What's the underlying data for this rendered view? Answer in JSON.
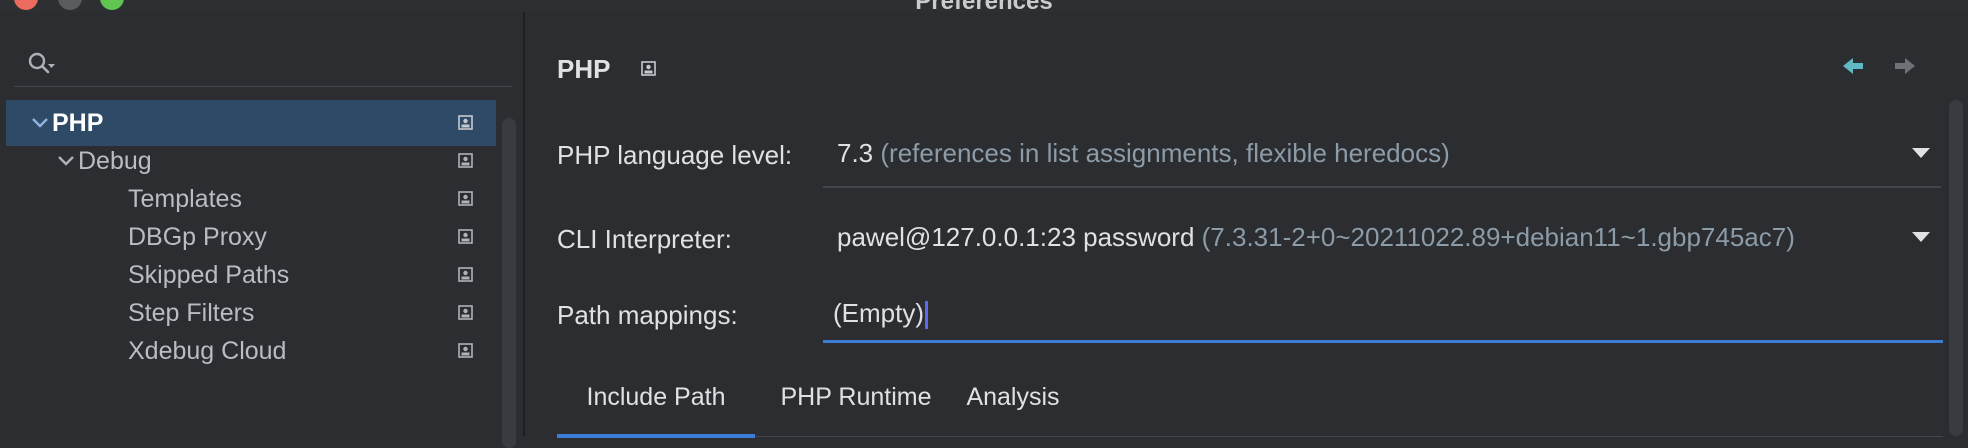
{
  "window": {
    "title": "Preferences"
  },
  "search": {
    "value": "",
    "placeholder": ""
  },
  "sidebar": {
    "items": [
      {
        "label": "PHP",
        "level": 0,
        "expanded": true,
        "selected": true
      },
      {
        "label": "Debug",
        "level": 1,
        "expanded": true,
        "selected": false
      },
      {
        "label": "Templates",
        "level": 2,
        "selected": false
      },
      {
        "label": "DBGp Proxy",
        "level": 2,
        "selected": false
      },
      {
        "label": "Skipped Paths",
        "level": 2,
        "selected": false
      },
      {
        "label": "Step Filters",
        "level": 2,
        "selected": false
      },
      {
        "label": "Xdebug Cloud",
        "level": 2,
        "selected": false
      }
    ]
  },
  "main": {
    "title": "PHP",
    "language_level": {
      "label": "PHP language level:",
      "value": "7.3",
      "detail": "(references in list assignments, flexible heredocs)"
    },
    "cli_interpreter": {
      "label": "CLI Interpreter:",
      "value": "pawel@127.0.0.1:23 password",
      "detail": "(7.3.31-2+0~20211022.89+debian11~1.gbp745ac7)"
    },
    "path_mappings": {
      "label": "Path mappings:",
      "value": "(Empty)"
    },
    "tabs": [
      {
        "label": "Include Path",
        "active": true
      },
      {
        "label": "PHP Runtime",
        "active": false
      },
      {
        "label": "Analysis",
        "active": false
      }
    ]
  },
  "colors": {
    "accent": "#3d7bd9",
    "selection": "#2e4a66",
    "nav_back": "#5fb8c4",
    "muted_text": "#8c9ba8"
  },
  "icons": {
    "search": "search-icon",
    "chevron": "chevron-down-icon",
    "page": "project-page-icon",
    "back": "arrow-left-icon",
    "forward": "arrow-right-icon",
    "dropdown": "dropdown-arrow-icon"
  }
}
